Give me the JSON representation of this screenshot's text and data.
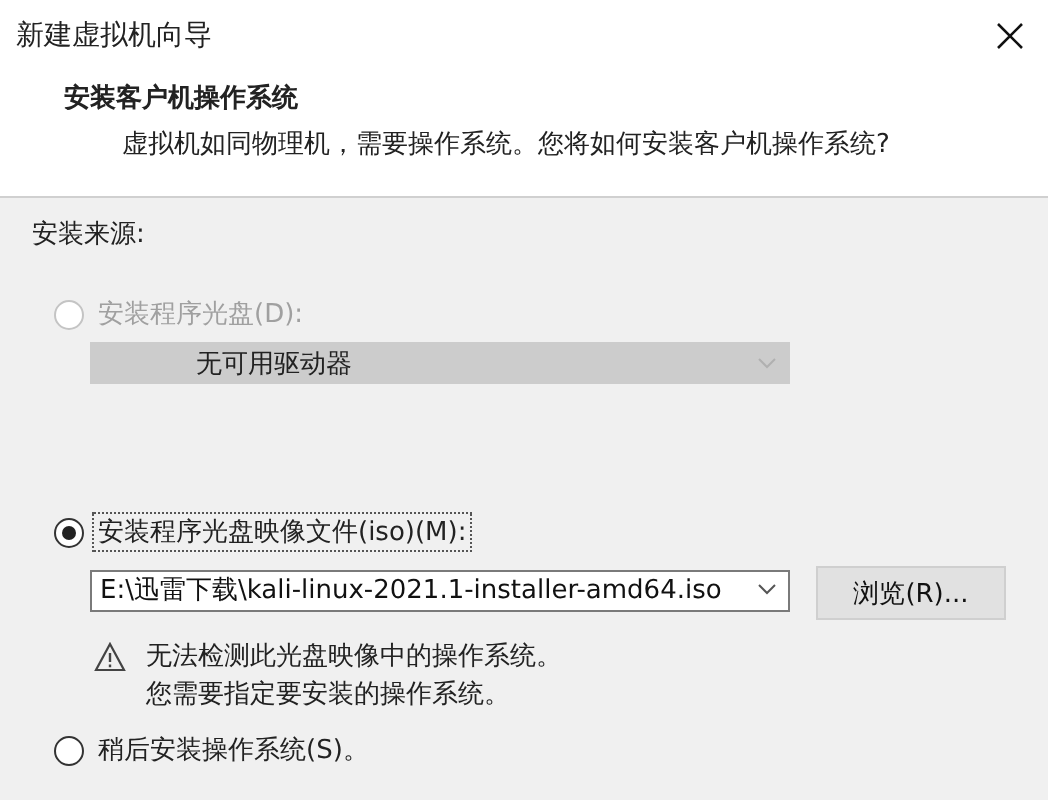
{
  "window": {
    "title": "新建虚拟机向导"
  },
  "header": {
    "title": "安装客户机操作系统",
    "subtitle": "虚拟机如同物理机，需要操作系统。您将如何安装客户机操作系统?"
  },
  "source": {
    "label": "安装来源:",
    "options": [
      {
        "label": "安装程序光盘(D):",
        "selected": false,
        "disabled": true,
        "dropdown": {
          "value": "无可用驱动器",
          "disabled": true
        }
      },
      {
        "label": "安装程序光盘映像文件(iso)(M):",
        "selected": true,
        "disabled": false,
        "dropdown": {
          "value": "E:\\迅雷下载\\kali-linux-2021.1-installer-amd64.iso",
          "disabled": false
        },
        "button": "浏览(R)...",
        "warning": [
          "无法检测此光盘映像中的操作系统。",
          "您需要指定要安装的操作系统。"
        ]
      },
      {
        "label": "稍后安装操作系统(S)。",
        "selected": false,
        "disabled": false
      }
    ]
  }
}
